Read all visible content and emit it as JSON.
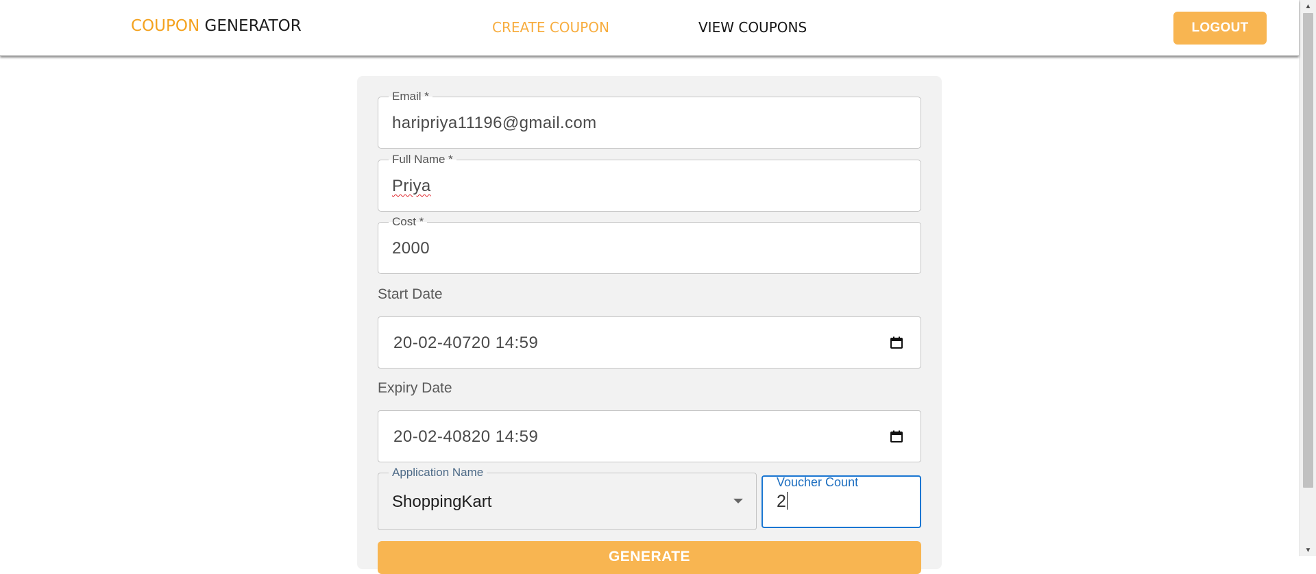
{
  "header": {
    "brand_accent": "COUPON",
    "brand_rest": " GENERATOR",
    "nav": {
      "create": "CREATE COUPON",
      "view": "VIEW COUPONS"
    },
    "logout_label": "LOGOUT"
  },
  "form": {
    "email": {
      "label": "Email *",
      "value": "haripriya11196@gmail.com"
    },
    "full_name": {
      "label": "Full Name *",
      "value": "Priya"
    },
    "cost": {
      "label": "Cost *",
      "value": "2000"
    },
    "start_date": {
      "label": "Start Date",
      "value": "20-02-40720  14:59"
    },
    "expiry_date": {
      "label": "Expiry Date",
      "value": "20-02-40820  14:59"
    },
    "application": {
      "label": "Application Name",
      "value": "ShoppingKart"
    },
    "voucher_count": {
      "label": "Voucher Count",
      "value": "2"
    },
    "generate_label": "GENERATE"
  },
  "colors": {
    "accent": "#f8b551",
    "brand_accent": "#f4a21e",
    "focus": "#1976d2",
    "card_bg": "#f2f2f2"
  },
  "icons": {
    "calendar": "calendar-icon",
    "dropdown": "chevron-down-icon"
  }
}
